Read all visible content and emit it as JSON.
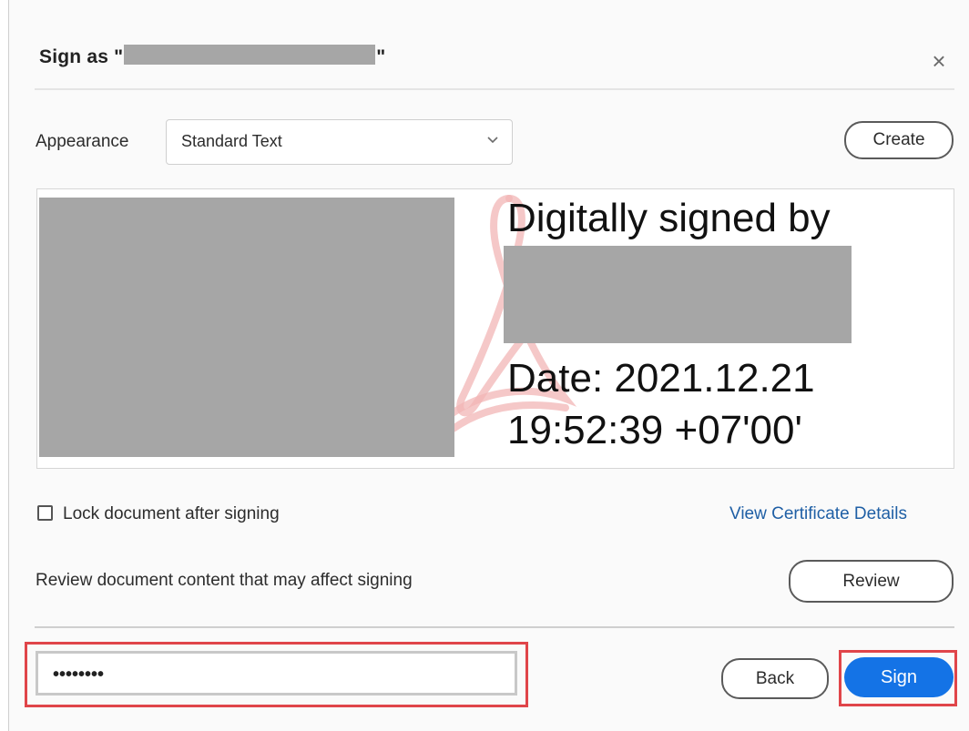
{
  "dialog": {
    "title_prefix": "Sign as \"",
    "title_suffix": "\"",
    "close_glyph": "×"
  },
  "appearance": {
    "label": "Appearance",
    "selected": "Standard Text",
    "create_label": "Create"
  },
  "preview": {
    "line1": "Digitally signed by",
    "line2": "Date: 2021.12.21",
    "line3": "19:52:39 +07'00'"
  },
  "options": {
    "lock_label": "Lock document after signing",
    "lock_checked": false,
    "view_cert_label": "View Certificate Details",
    "review_text": "Review document content that may affect signing",
    "review_label": "Review"
  },
  "footer": {
    "password_value": "••••••••",
    "back_label": "Back",
    "sign_label": "Sign"
  },
  "colors": {
    "accent": "#1473e6",
    "link": "#1f5fa5",
    "highlight": "#e0454a",
    "redaction": "#a6a6a6"
  }
}
